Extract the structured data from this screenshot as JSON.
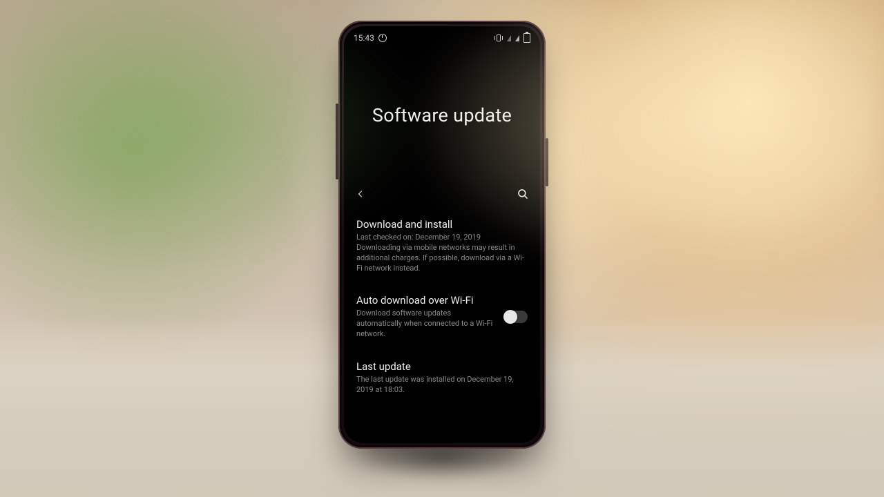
{
  "statusbar": {
    "time": "15:43"
  },
  "hero": {
    "title": "Software update"
  },
  "items": {
    "download": {
      "title": "Download and install",
      "sub": "Last checked on: December 19, 2019\nDownloading via mobile networks may result in additional charges. If possible, download via a Wi-Fi network instead."
    },
    "auto": {
      "title": "Auto download over Wi-Fi",
      "sub": "Download software updates automatically when connected to a Wi-Fi network.",
      "toggle_on": false
    },
    "last": {
      "title": "Last update",
      "sub": "The last update was installed on December 19, 2019 at 18:03."
    }
  }
}
